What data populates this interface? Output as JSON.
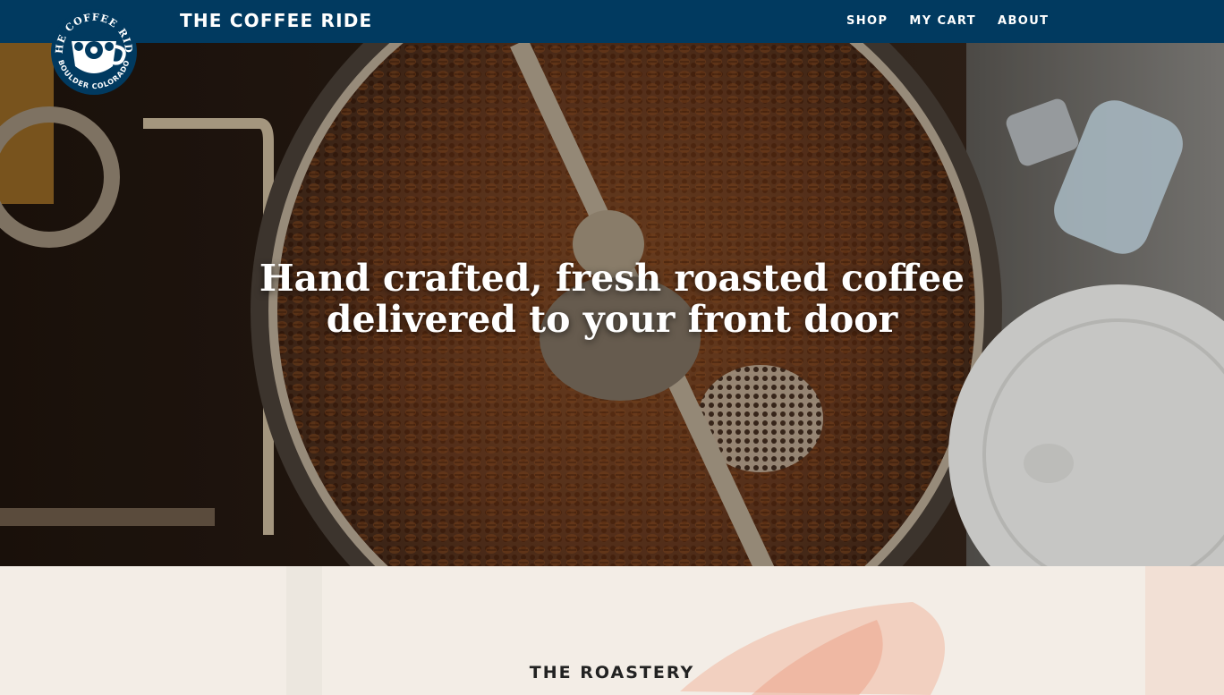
{
  "header": {
    "brand": "THE COFFEE RIDE",
    "logo_top_text": "THE COFFEE RIDE",
    "logo_bottom_text": "BOULDER COLORADO",
    "nav": [
      {
        "label": "SHOP"
      },
      {
        "label": "MY CART"
      },
      {
        "label": "ABOUT"
      }
    ]
  },
  "hero": {
    "headline": "Hand crafted, fresh roasted coffee delivered to your front door"
  },
  "section": {
    "title": "THE ROASTERY"
  },
  "colors": {
    "header_bg": "#013a60",
    "text_light": "#ffffff",
    "section_bg": "#f3ede6"
  }
}
